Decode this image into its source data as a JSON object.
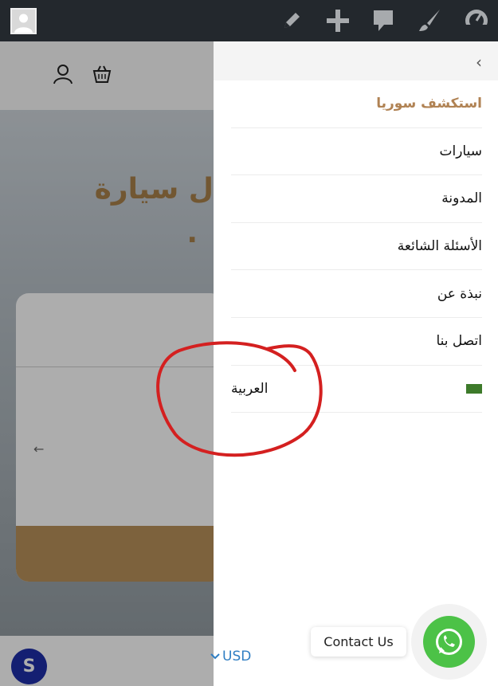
{
  "adminbar": {
    "icons": [
      "avatar",
      "pencil-icon",
      "plus-icon",
      "comment-icon",
      "brush-icon",
      "dashboard-icon"
    ]
  },
  "background": {
    "hero_title": "ل سيارة",
    "hero_sub": ".",
    "card_arrow": "←",
    "logo_letter": "S"
  },
  "drawer": {
    "back": "‹",
    "items": [
      {
        "label": "استكشف سوريا",
        "active": true
      },
      {
        "label": "سيارات"
      },
      {
        "label": "المدونة"
      },
      {
        "label": "الأسئلة الشائعة"
      },
      {
        "label": "نبذة عن"
      },
      {
        "label": "اتصل بنا"
      }
    ],
    "language": "العربية"
  },
  "currency": "USD",
  "contact": {
    "label": "Contact Us"
  },
  "colors": {
    "accent": "#b08253",
    "whatsapp": "#4cc247",
    "link": "#2f7ec3",
    "annotation": "#d42020"
  }
}
